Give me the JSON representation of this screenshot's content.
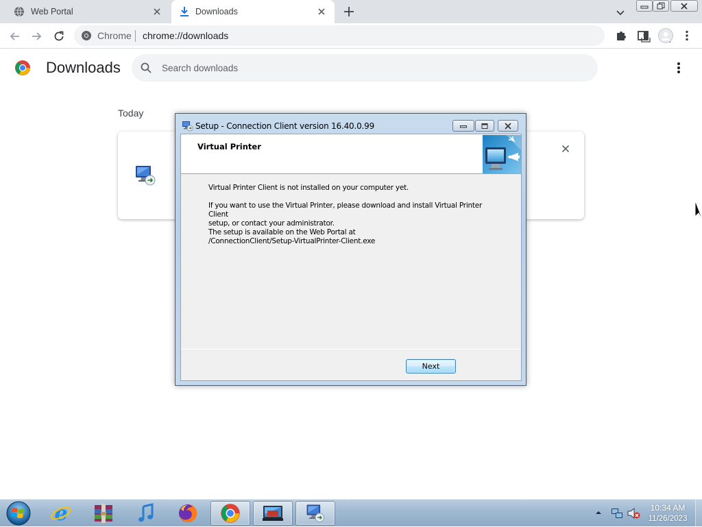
{
  "browser": {
    "tabs": [
      {
        "label": "Web Portal",
        "icon": "globe-icon",
        "active": false
      },
      {
        "label": "Downloads",
        "icon": "download-icon",
        "active": true
      }
    ],
    "omnibox": {
      "site_label": "Chrome",
      "url": "chrome://downloads"
    }
  },
  "downloads_page": {
    "title": "Downloads",
    "search_placeholder": "Search downloads",
    "date_heading": "Today"
  },
  "dialog": {
    "title": "Setup - Connection Client version 16.40.0.99",
    "header_title": "Virtual Printer",
    "paragraph1": "Virtual Printer Client is not installed on your computer yet.",
    "paragraph2_lines": [
      "If you want to use the Virtual Printer, please download and install Virtual Printer Client",
      "setup, or contact your administrator.",
      "The setup is available on the Web Portal at",
      "/ConnectionClient/Setup-VirtualPrinter-Client.exe"
    ],
    "next_label": "Next"
  },
  "taskbar": {
    "apps": [
      "internet-explorer",
      "winrar",
      "itunes",
      "firefox",
      "chrome",
      "remote-desktop",
      "setup"
    ],
    "clock_time": "10:34 AM",
    "clock_date": "11/26/2023"
  },
  "colors": {
    "tabstrip": "#dee1e6",
    "dialog_frame": "#b7cfe8",
    "taskbar": "#9fb9d1",
    "next_button_border": "#3c7fb1"
  }
}
